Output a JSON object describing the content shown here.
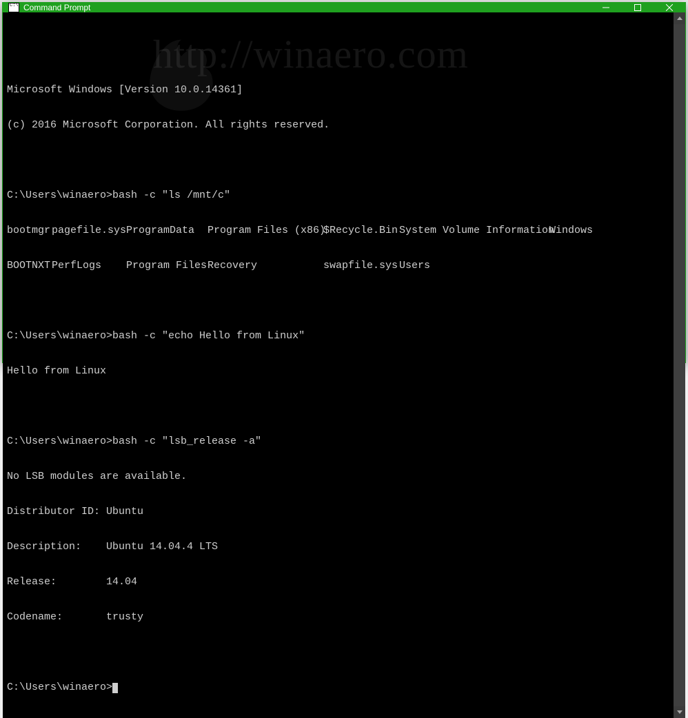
{
  "window": {
    "title": "Command Prompt"
  },
  "watermark": "http://winaero.com",
  "header": {
    "version": "Microsoft Windows [Version 10.0.14361]",
    "copyright": "(c) 2016 Microsoft Corporation. All rights reserved."
  },
  "block1": {
    "prompt": "C:\\Users\\winaero>bash -c \"ls /mnt/c\"",
    "row1": {
      "c1": "bootmgr",
      "c2": "pagefile.sys",
      "c3": "ProgramData",
      "c4": "Program Files (x86)",
      "c5": "$Recycle.Bin",
      "c6": "System Volume Information",
      "c7": "Windows"
    },
    "row2": {
      "c1": "BOOTNXT",
      "c2": "PerfLogs",
      "c3": "Program Files",
      "c4": "Recovery",
      "c5": "swapfile.sys",
      "c6": "Users",
      "c7": ""
    }
  },
  "block2": {
    "prompt": "C:\\Users\\winaero>bash -c \"echo Hello from Linux\"",
    "output": "Hello from Linux"
  },
  "block3": {
    "prompt": "C:\\Users\\winaero>bash -c \"lsb_release -a\"",
    "l1": "No LSB modules are available.",
    "l2": "Distributor ID: Ubuntu",
    "l3": "Description:    Ubuntu 14.04.4 LTS",
    "l4": "Release:        14.04",
    "l5": "Codename:       trusty"
  },
  "final_prompt": "C:\\Users\\winaero>"
}
